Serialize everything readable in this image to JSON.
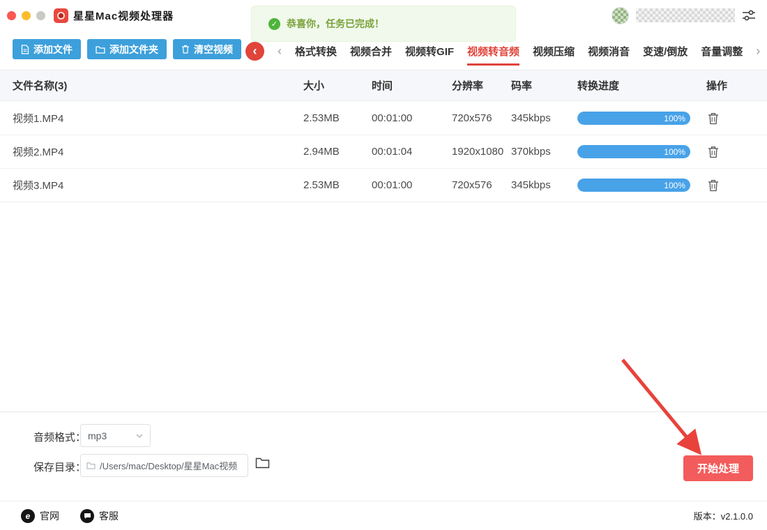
{
  "window": {
    "title": "星星Mac视频处理器"
  },
  "toast": {
    "message": "恭喜你，任务已完成！",
    "check": "✓"
  },
  "toolbar": {
    "add_file": "添加文件",
    "add_folder": "添加文件夹",
    "clear_videos": "清空视频"
  },
  "tabs": {
    "back": "‹",
    "prev": "‹",
    "next": "›",
    "items": [
      {
        "label": "格式转换",
        "active": false
      },
      {
        "label": "视频合并",
        "active": false
      },
      {
        "label": "视频转GIF",
        "active": false
      },
      {
        "label": "视频转音频",
        "active": true
      },
      {
        "label": "视频压缩",
        "active": false
      },
      {
        "label": "视频消音",
        "active": false
      },
      {
        "label": "变速/倒放",
        "active": false
      },
      {
        "label": "音量调整",
        "active": false
      }
    ]
  },
  "table": {
    "headers": {
      "name": "文件名称(3)",
      "size": "大小",
      "time": "时间",
      "resolution": "分辨率",
      "bitrate": "码率",
      "progress": "转换进度",
      "action": "操作"
    },
    "rows": [
      {
        "name": "视频1.MP4",
        "size": "2.53MB",
        "time": "00:01:00",
        "resolution": "720x576",
        "bitrate": "345kbps",
        "progress": "100%"
      },
      {
        "name": "视频2.MP4",
        "size": "2.94MB",
        "time": "00:01:04",
        "resolution": "1920x1080",
        "bitrate": "370kbps",
        "progress": "100%"
      },
      {
        "name": "视频3.MP4",
        "size": "2.53MB",
        "time": "00:01:00",
        "resolution": "720x576",
        "bitrate": "345kbps",
        "progress": "100%"
      }
    ]
  },
  "panel": {
    "audio_format_label": "音频格式：",
    "audio_format_value": "mp3",
    "save_dir_label": "保存目录：",
    "save_dir_value": "/Users/mac/Desktop/星星Mac视频",
    "start_button": "开始处理"
  },
  "footer": {
    "official_site": "官网",
    "official_site_icon_letter": "e",
    "support": "客服",
    "version": "版本：v2.1.0.0"
  },
  "colors": {
    "primary_blue": "#3da0db",
    "active_red": "#e0433a",
    "progress_blue": "#48a2e8",
    "toast_green_bg": "#f0f9eb",
    "toast_green_text": "#7ba23d",
    "start_button_red": "#f35c5c",
    "annotation_red": "#e8423b"
  }
}
